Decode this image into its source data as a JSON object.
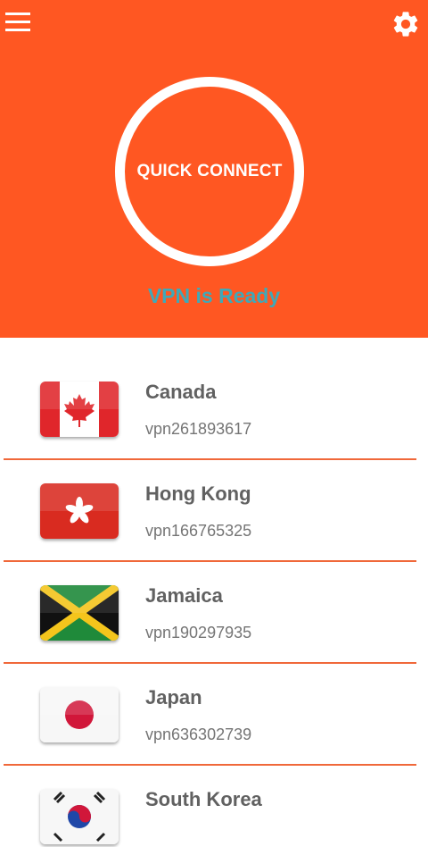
{
  "header": {
    "menu_icon": "hamburger-menu-icon",
    "settings_icon": "gear-icon",
    "quick_connect_label": "QUICK CONNECT",
    "status_text": "VPN is Ready",
    "accent_color": "#ff5722",
    "status_color": "#3fa9b8"
  },
  "servers": [
    {
      "country": "Canada",
      "server": "vpn261893617",
      "flag_icon": "canada-flag-icon"
    },
    {
      "country": "Hong Kong",
      "server": "vpn166765325",
      "flag_icon": "hong-kong-flag-icon"
    },
    {
      "country": "Jamaica",
      "server": "vpn190297935",
      "flag_icon": "jamaica-flag-icon"
    },
    {
      "country": "Japan",
      "server": "vpn636302739",
      "flag_icon": "japan-flag-icon"
    },
    {
      "country": "South Korea",
      "server": "",
      "flag_icon": "south-korea-flag-icon"
    }
  ]
}
